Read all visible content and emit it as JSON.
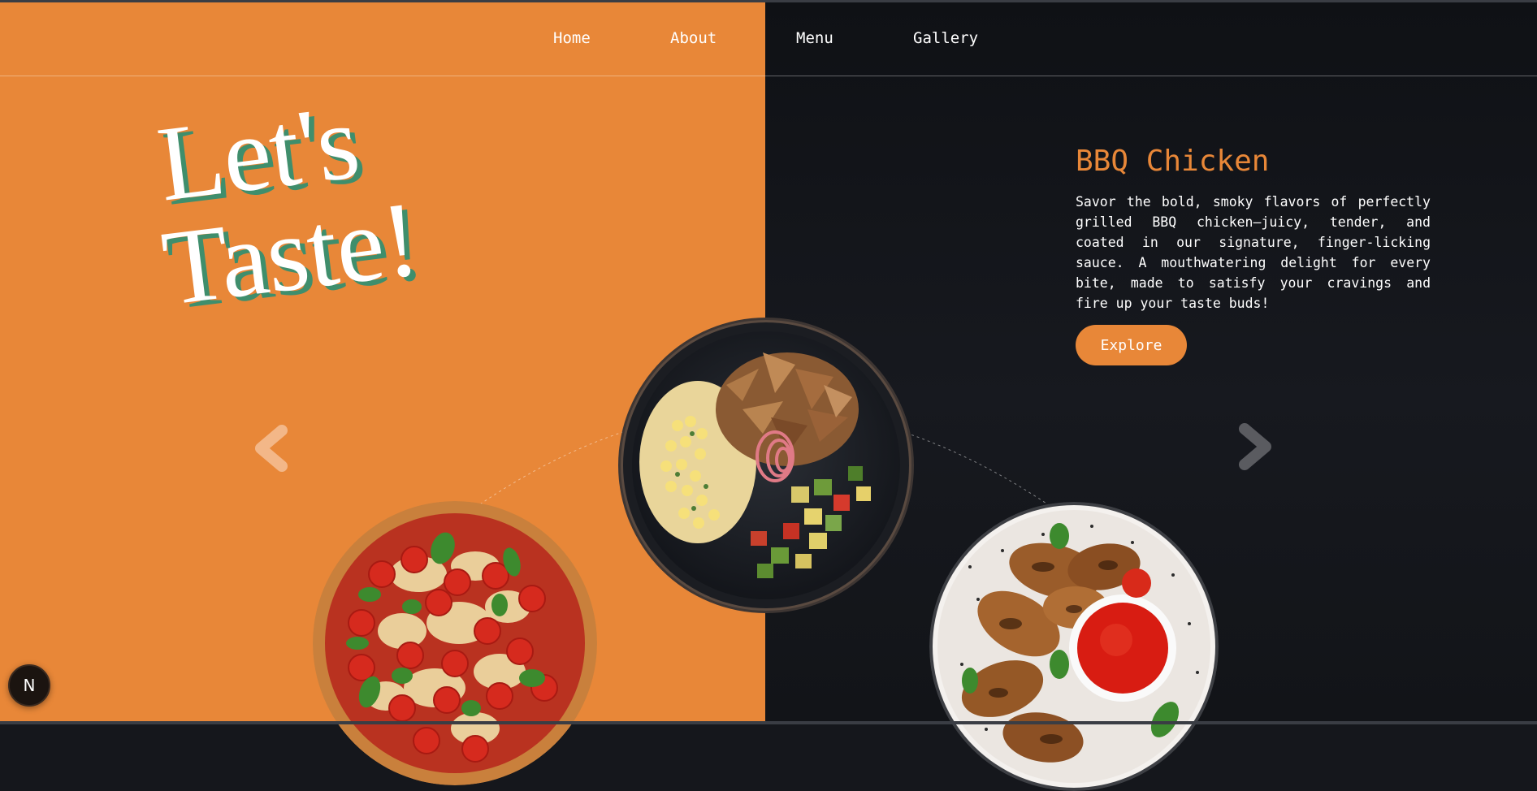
{
  "nav": {
    "items": [
      {
        "label": "Home"
      },
      {
        "label": "About"
      },
      {
        "label": "Menu"
      },
      {
        "label": "Gallery"
      }
    ]
  },
  "hero": {
    "title_line1": "Let's",
    "title_line2": "Taste!"
  },
  "dish": {
    "title": "BBQ Chicken",
    "description": "Savor the bold, smoky flavors of perfectly grilled BBQ chicken—juicy, tender, and coated in our signature, finger-licking sauce. A mouthwatering delight for every bite, made to satisfy your cravings and fire up your taste buds!",
    "button_label": "Explore"
  },
  "carousel": {
    "prev_icon": "chevron-left-icon",
    "next_icon": "chevron-right-icon"
  },
  "dev_badge": {
    "label": "N"
  },
  "colors": {
    "accent": "#e88738",
    "dark_bg": "#15171c",
    "title_shadow": "#3f8e6c"
  }
}
